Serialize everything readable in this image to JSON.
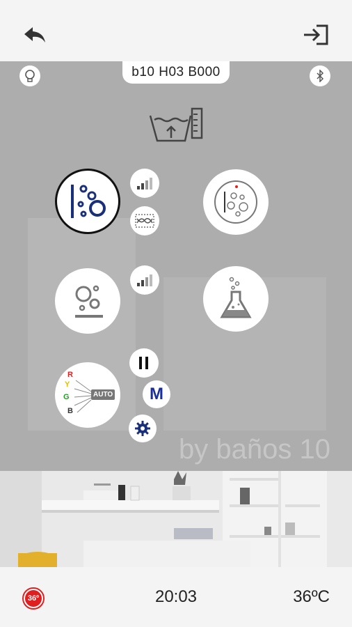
{
  "device": {
    "id": "b10 H03 B000"
  },
  "toolbar": {
    "back_icon": "back-arrow-icon",
    "logout_icon": "logout-icon"
  },
  "status": {
    "light_icon": "lightbulb-icon",
    "bluetooth_icon": "bluetooth-icon"
  },
  "watermark": {
    "logo": "b10",
    "tagline": "by baños 10"
  },
  "controls": {
    "auto_label": "AUTO",
    "color_letters": [
      "R",
      "Y",
      "G",
      "B"
    ],
    "mode_label": "M"
  },
  "footer": {
    "badge": "36º",
    "time": "20:03",
    "temperature": "36ºC"
  },
  "colors": {
    "accent_blue": "#1a2f7a",
    "badge_red": "#e02020",
    "panel_gray": "#adadad"
  }
}
